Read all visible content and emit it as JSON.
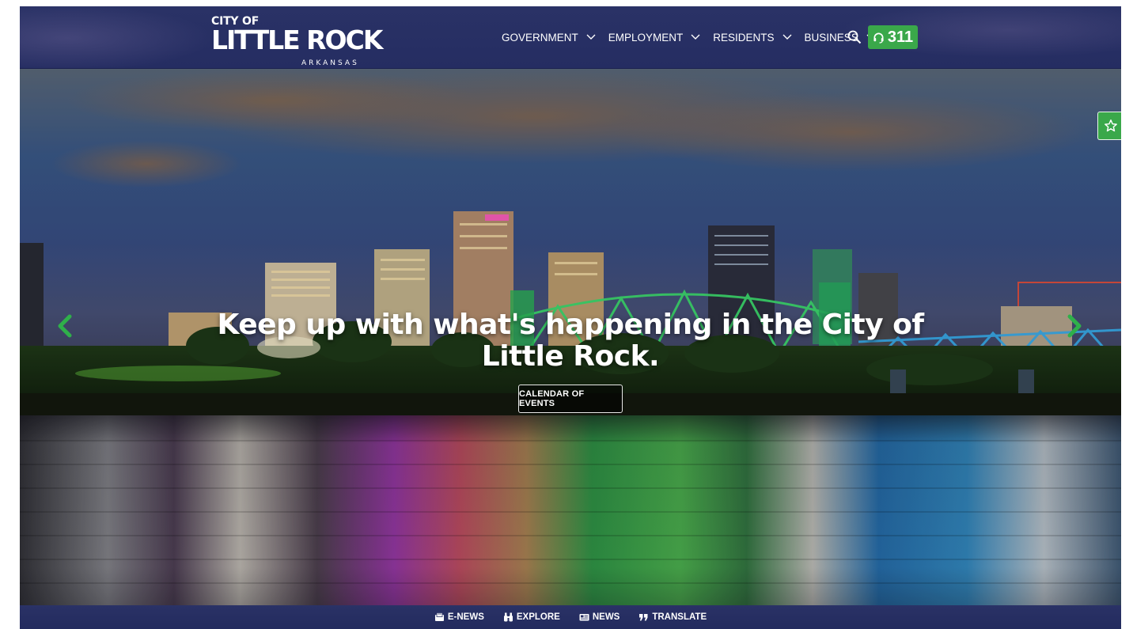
{
  "header": {
    "logo": {
      "line1": "CITY OF",
      "line2": "LITTLE ROCK",
      "line3": "ARKANSAS"
    },
    "nav": [
      {
        "label": "GOVERNMENT"
      },
      {
        "label": "EMPLOYMENT"
      },
      {
        "label": "RESIDENTS"
      },
      {
        "label": "BUSINESS"
      }
    ],
    "search_icon": "search-icon",
    "button_311": {
      "label": "311",
      "icon": "headset-icon"
    }
  },
  "hero": {
    "headline": "Keep up with what's happening in the City of Little Rock.",
    "cta_label": "CALENDAR OF EVENTS",
    "prev_icon": "chevron-left-icon",
    "next_icon": "chevron-right-icon",
    "favorite_icon": "star-icon"
  },
  "bottom_bar": [
    {
      "label": "E-NEWS",
      "icon": "newsletter-icon"
    },
    {
      "label": "EXPLORE",
      "icon": "binoculars-icon"
    },
    {
      "label": "NEWS",
      "icon": "newspaper-icon"
    },
    {
      "label": "TRANSLATE",
      "icon": "quote-icon"
    }
  ],
  "colors": {
    "header_bg": "#2a3266",
    "accent_green": "#3aa84a",
    "text_white": "#ffffff"
  }
}
